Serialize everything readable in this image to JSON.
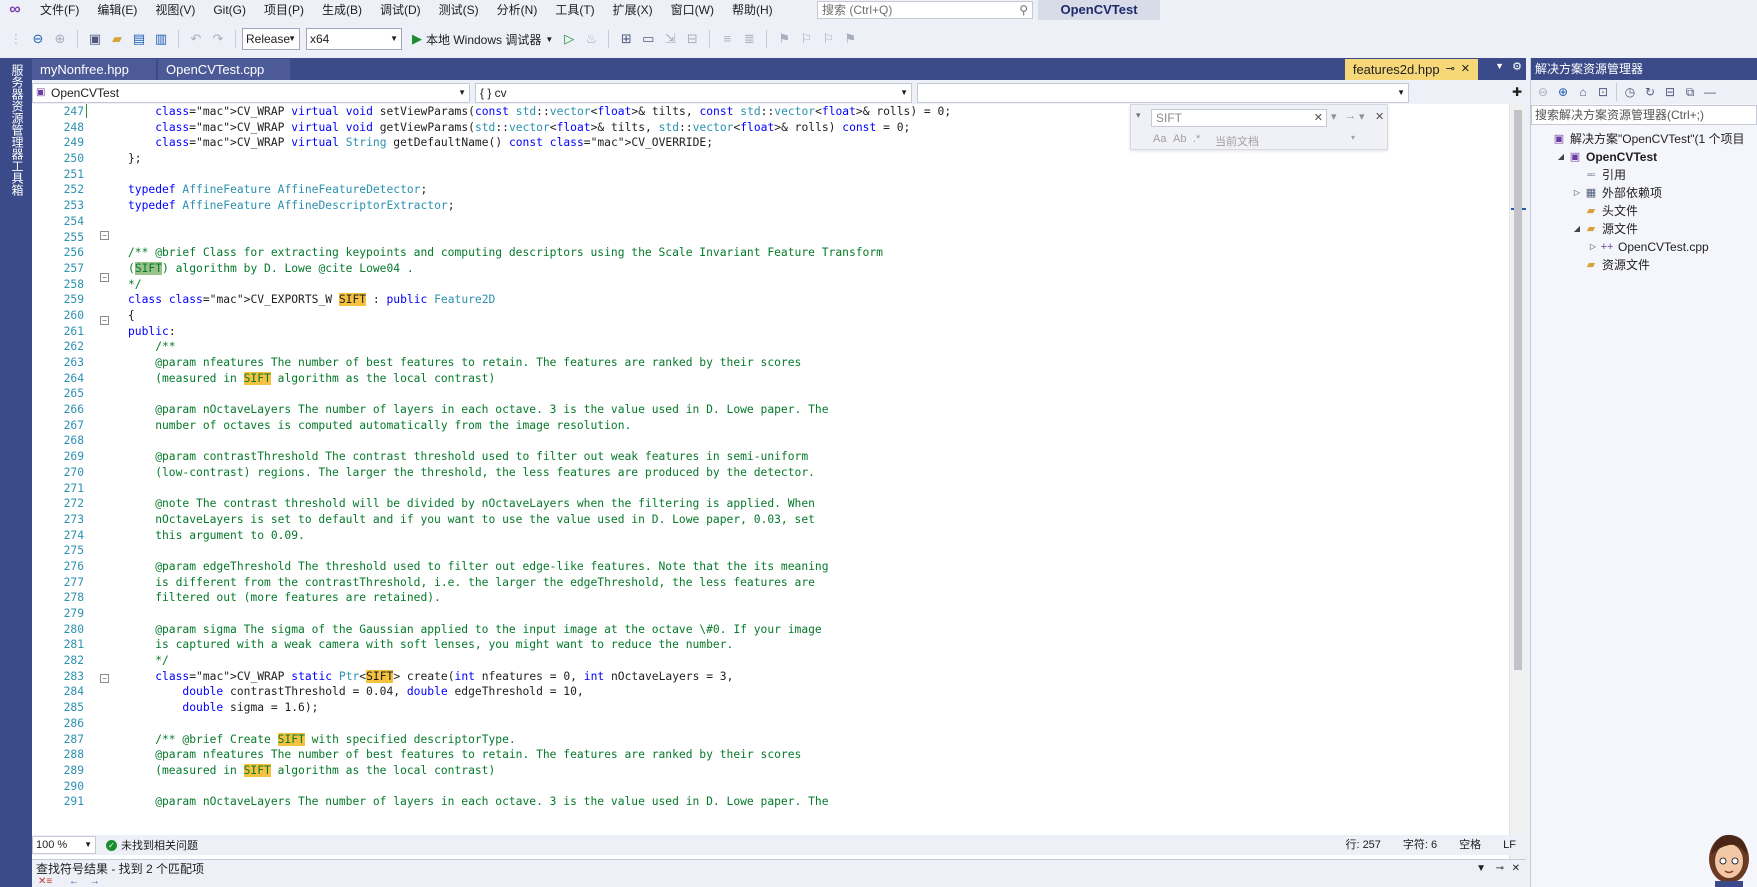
{
  "menubar": {
    "items": [
      "文件(F)",
      "编辑(E)",
      "视图(V)",
      "Git(G)",
      "项目(P)",
      "生成(B)",
      "调试(D)",
      "测试(S)",
      "分析(N)",
      "工具(T)",
      "扩展(X)",
      "窗口(W)",
      "帮助(H)"
    ],
    "search_placeholder": "搜索 (Ctrl+Q)",
    "project_name": "OpenCVTest"
  },
  "toolbar": {
    "config": "Release",
    "platform": "x64",
    "run_label": "本地 Windows 调试器"
  },
  "left_rail": {
    "server_explorer": "服务器资源管理器",
    "toolbox": "工具箱"
  },
  "doc_tabs": {
    "tabs": [
      "myNonfree.hpp",
      "OpenCVTest.cpp"
    ],
    "active": "features2d.hpp"
  },
  "navbar": {
    "project": "OpenCVTest",
    "scope": "{ } cv",
    "member": ""
  },
  "find": {
    "query": "SIFT",
    "match_case": "Aa",
    "whole_word": "Ab",
    "regex": ".*",
    "scope": "当前文档"
  },
  "code": {
    "line_numbers": [
      247,
      248,
      249,
      250,
      251,
      252,
      253,
      254,
      255,
      256,
      257,
      258,
      259,
      260,
      261,
      262,
      263,
      264,
      265,
      266,
      267,
      268,
      269,
      270,
      271,
      272,
      273,
      274,
      275,
      276,
      277,
      278,
      279,
      280,
      281,
      282,
      283,
      284,
      285,
      286,
      287,
      288,
      289,
      290,
      291
    ],
    "lines": [
      "    CV_WRAP virtual void setViewParams(const std::vector<float>& tilts, const std::vector<float>& rolls) = 0;",
      "    CV_WRAP virtual void getViewParams(std::vector<float>& tilts, std::vector<float>& rolls) const = 0;",
      "    CV_WRAP virtual String getDefaultName() const CV_OVERRIDE;",
      "};",
      "",
      "typedef AffineFeature AffineFeatureDetector;",
      "typedef AffineFeature AffineDescriptorExtractor;",
      "",
      "",
      "/** @brief Class for extracting keypoints and computing descriptors using the Scale Invariant Feature Transform",
      "(SIFT) algorithm by D. Lowe @cite Lowe04 .",
      "*/",
      "class CV_EXPORTS_W SIFT : public Feature2D",
      "{",
      "public:",
      "    /**",
      "    @param nfeatures The number of best features to retain. The features are ranked by their scores",
      "    (measured in SIFT algorithm as the local contrast)",
      "",
      "    @param nOctaveLayers The number of layers in each octave. 3 is the value used in D. Lowe paper. The",
      "    number of octaves is computed automatically from the image resolution.",
      "",
      "    @param contrastThreshold The contrast threshold used to filter out weak features in semi-uniform",
      "    (low-contrast) regions. The larger the threshold, the less features are produced by the detector.",
      "",
      "    @note The contrast threshold will be divided by nOctaveLayers when the filtering is applied. When",
      "    nOctaveLayers is set to default and if you want to use the value used in D. Lowe paper, 0.03, set",
      "    this argument to 0.09.",
      "",
      "    @param edgeThreshold The threshold used to filter out edge-like features. Note that the its meaning",
      "    is different from the contrastThreshold, i.e. the larger the edgeThreshold, the less features are",
      "    filtered out (more features are retained).",
      "",
      "    @param sigma The sigma of the Gaussian applied to the input image at the octave \\#0. If your image",
      "    is captured with a weak camera with soft lenses, you might want to reduce the number.",
      "    */",
      "    CV_WRAP static Ptr<SIFT> create(int nfeatures = 0, int nOctaveLayers = 3,",
      "        double contrastThreshold = 0.04, double edgeThreshold = 10,",
      "        double sigma = 1.6);",
      "",
      "    /** @brief Create SIFT with specified descriptorType.",
      "    @param nfeatures The number of best features to retain. The features are ranked by their scores",
      "    (measured in SIFT algorithm as the local contrast)",
      "",
      "    @param nOctaveLayers The number of layers in each octave. 3 is the value used in D. Lowe paper. The"
    ]
  },
  "editor_status": {
    "zoom": "100 %",
    "issues": "未找到相关问题",
    "line": "行: 257",
    "col": "字符: 6",
    "indent": "空格",
    "eol": "LF"
  },
  "results_panel": {
    "title": "查找符号结果 - 找到 2 个匹配项"
  },
  "solution_explorer": {
    "title": "解决方案资源管理器",
    "search_placeholder": "搜索解决方案资源管理器(Ctrl+;)",
    "tree": [
      {
        "label": "解决方案\"OpenCVTest\"(1 个项目",
        "indent": 0,
        "exp": "",
        "icon": "solution-icon",
        "bold": false
      },
      {
        "label": "OpenCVTest",
        "indent": 1,
        "exp": "◢",
        "icon": "project-icon",
        "bold": true
      },
      {
        "label": "引用",
        "indent": 2,
        "exp": "",
        "icon": "references-icon",
        "bold": false
      },
      {
        "label": "外部依赖项",
        "indent": 2,
        "exp": "▷",
        "icon": "external-deps-icon",
        "bold": false
      },
      {
        "label": "头文件",
        "indent": 2,
        "exp": "",
        "icon": "folder-icon",
        "bold": false
      },
      {
        "label": "源文件",
        "indent": 2,
        "exp": "◢",
        "icon": "folder-icon",
        "bold": false
      },
      {
        "label": "OpenCVTest.cpp",
        "indent": 3,
        "exp": "▷",
        "icon": "cpp-file-icon",
        "bold": false
      },
      {
        "label": "资源文件",
        "indent": 2,
        "exp": "",
        "icon": "folder-icon",
        "bold": false
      }
    ]
  },
  "colors": {
    "accent": "#3b4b8a",
    "active_tab": "#f7d879",
    "match_highlight": "#f5c23f",
    "keyword": "#0000ff",
    "comment": "#057a2a",
    "type": "#2b91af"
  }
}
